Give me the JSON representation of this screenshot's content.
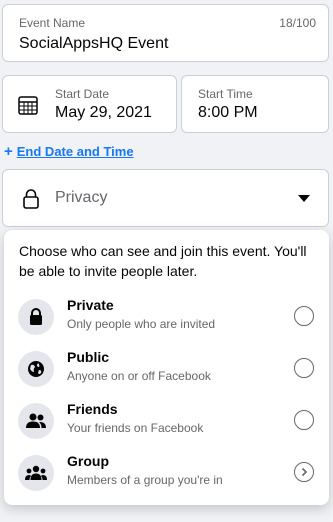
{
  "event_name": {
    "label": "Event Name",
    "counter": "18/100",
    "value": "SocialAppsHQ Event"
  },
  "start_date": {
    "label": "Start Date",
    "value": "May 29, 2021",
    "icon": "calendar-icon"
  },
  "start_time": {
    "label": "Start Time",
    "value": "8:00 PM"
  },
  "end_date_link": {
    "plus": "+",
    "label": "End Date and Time"
  },
  "privacy": {
    "placeholder": "Privacy",
    "icon": "lock-icon"
  },
  "privacy_menu": {
    "description": "Choose who can see and join this event. You'll be able to invite people later.",
    "options": [
      {
        "title": "Private",
        "subtitle": "Only people who are invited",
        "icon": "lock-icon",
        "control": "radio"
      },
      {
        "title": "Public",
        "subtitle": "Anyone on or off Facebook",
        "icon": "globe-icon",
        "control": "radio"
      },
      {
        "title": "Friends",
        "subtitle": "Your friends on Facebook",
        "icon": "friends-icon",
        "control": "radio"
      },
      {
        "title": "Group",
        "subtitle": "Members of a group you're in",
        "icon": "group-icon",
        "control": "chevron"
      }
    ]
  },
  "colors": {
    "accent": "#1877f2",
    "background": "#f0f2f5",
    "secondary_text": "#65676b",
    "icon_circle": "#e4e6eb"
  }
}
